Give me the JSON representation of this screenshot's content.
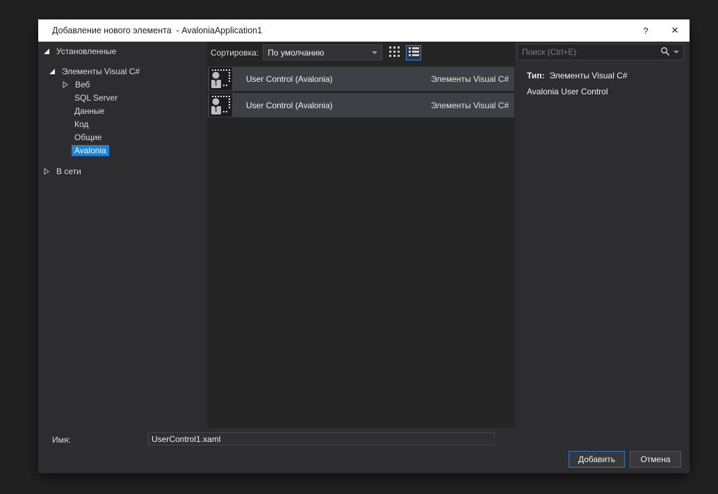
{
  "window": {
    "title": "Добавление нового элемента  - AvaloniaApplication1",
    "help": "?",
    "close": "✕"
  },
  "tree": {
    "items": [
      {
        "label": "Установленные",
        "state": "expanded",
        "selected": false
      },
      {
        "label": "Элементы Visual C#",
        "state": "expanded",
        "selected": false
      },
      {
        "label": "Веб",
        "state": "collapsed",
        "selected": false
      },
      {
        "label": "SQL Server",
        "state": "none",
        "selected": false
      },
      {
        "label": "Данные",
        "state": "none",
        "selected": false
      },
      {
        "label": "Код",
        "state": "none",
        "selected": false
      },
      {
        "label": "Общие",
        "state": "none",
        "selected": false
      },
      {
        "label": "Avalonia",
        "state": "none",
        "selected": true
      },
      {
        "label": "В сети",
        "state": "collapsed",
        "selected": false
      }
    ]
  },
  "toolbar": {
    "sort_label": "Сортировка:",
    "sort_value": "По умолчанию",
    "views": [
      {
        "icon": "medium-icons-view-icon",
        "active": false
      },
      {
        "icon": "list-view-icon",
        "active": true
      }
    ]
  },
  "list": {
    "items": [
      {
        "name": "User Control (Avalonia)",
        "category": "Элементы Visual C#",
        "icon": "user-control-avalonia-icon"
      },
      {
        "name": "User Control (Avalonia)",
        "category": "Элементы Visual C#",
        "icon": "user-control-avalonia-icon"
      }
    ]
  },
  "search": {
    "placeholder": "Поиск (Ctrl+E)",
    "icon": "search-icon"
  },
  "info": {
    "type_label": "Тип:",
    "type_value": "Элементы Visual C#",
    "description": "Avalonia User Control"
  },
  "footer": {
    "name_label": "Имя:",
    "name_value": "UserControl1.xaml",
    "add_label": "Добавить",
    "cancel_label": "Отмена"
  },
  "colors": {
    "accent": "#1c83d8",
    "titlebar_bg": "#ffffff",
    "dialog_bg": "#2d2d30",
    "list_panel_bg": "#252526",
    "row_bg": "#3f4045",
    "primary_button_border": "#3379c4"
  }
}
